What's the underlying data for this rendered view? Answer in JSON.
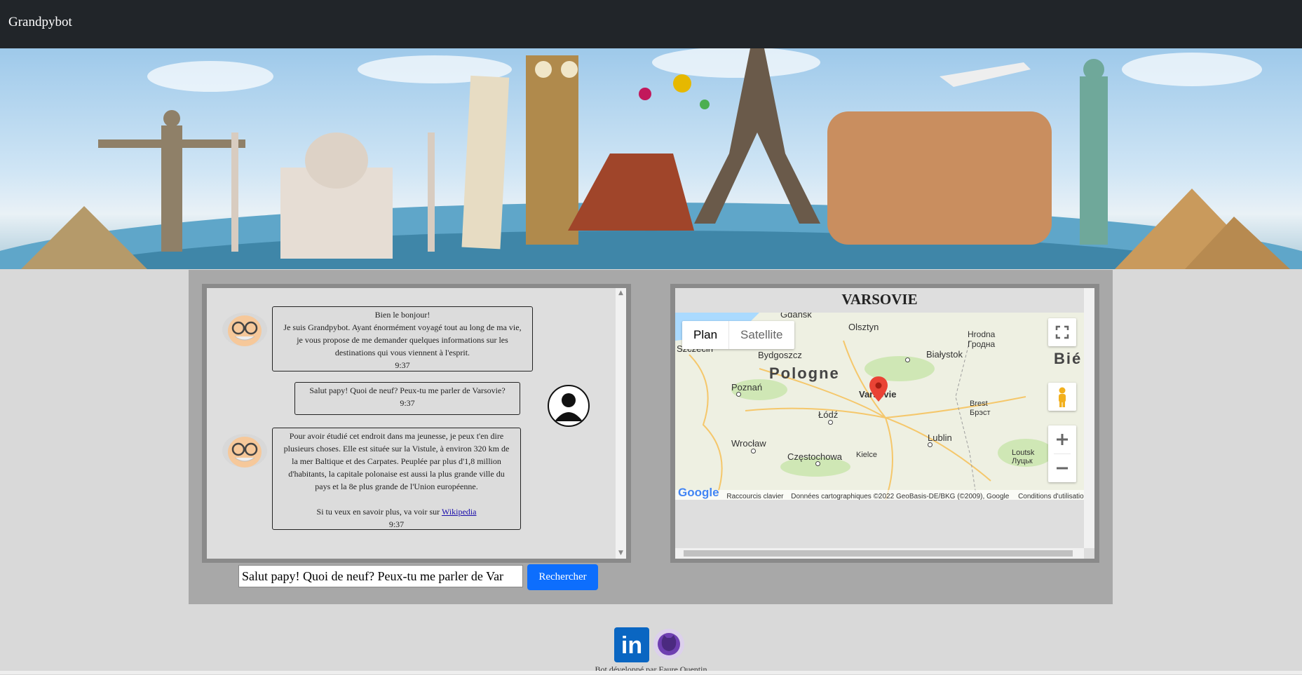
{
  "navbar": {
    "brand": "Grandpybot"
  },
  "chat": {
    "messages": [
      {
        "sender": "bot",
        "lines": [
          "Bien le bonjour!",
          "Je suis Grandpybot. Ayant énormément voyagé tout au long de ma vie,",
          "je vous propose de me demander quelques informations sur les",
          "destinations qui vous viennent à l'esprit."
        ],
        "time": "9:37"
      },
      {
        "sender": "user",
        "lines": [
          "Salut papy! Quoi de neuf? Peux-tu me parler de Varsovie?"
        ],
        "time": "9:37"
      },
      {
        "sender": "bot",
        "lines": [
          "Pour avoir étudié cet endroit dans ma jeunesse, je peux t'en dire",
          "plusieurs choses. Elle est située sur la Vistule, à environ 320 km de",
          "la mer Baltique et des Carpates. Peuplée par plus d'1,8 million",
          "d'habitants, la capitale polonaise est aussi la plus grande ville du",
          "pays et la 8e plus grande de l'Union européenne."
        ],
        "link_prefix": "Si tu veux en savoir plus, va voir sur ",
        "link_text": "Wikipedia",
        "time": "9:37"
      }
    ]
  },
  "search": {
    "value": "Salut papy! Quoi de neuf? Peux-tu me parler de Var",
    "button": "Rechercher"
  },
  "map": {
    "title": "VARSOVIE",
    "type_plan": "Plan",
    "type_satellite": "Satellite",
    "country": "Pologne",
    "country_right": "Bié",
    "cities": {
      "gdansk": "Gdańsk",
      "olsztyn": "Olsztyn",
      "hrodna": "Hrodna",
      "hrodna_cyr": "Гродна",
      "szczecin": "Szczecin",
      "bydgoszcz": "Bydgoszcz",
      "bialystok": "Białystok",
      "poznan": "Poznań",
      "varsovie": "Varsovie",
      "brest": "Brest",
      "brest_cyr": "Брэст",
      "lodz": "Łódź",
      "wroclaw": "Wrocław",
      "lublin": "Lublin",
      "czestochowa": "Częstochowa",
      "kielce": "Kielce",
      "loutsk": "Loutsk",
      "loutsk_cyr": "Луцьк"
    },
    "attribution": {
      "logo": "Google",
      "shortcuts": "Raccourcis clavier",
      "data": "Données cartographiques ©2022 GeoBasis-DE/BKG (©2009), Google",
      "terms": "Conditions d'utilisation"
    }
  },
  "footer": {
    "linkedin": "in",
    "text": "Bot développé par Faure Quentin"
  },
  "colors": {
    "navbar": "#212529",
    "button": "#0d6efd",
    "marker": "#ea4335"
  }
}
